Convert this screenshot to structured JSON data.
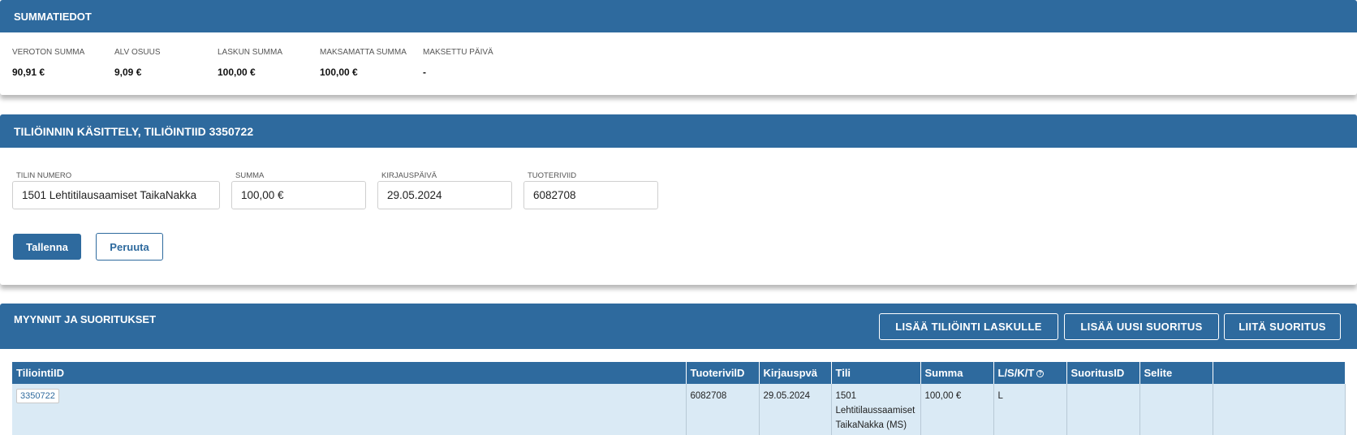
{
  "summary": {
    "title": "SUMMATIEDOT",
    "items": [
      {
        "label": "VEROTON SUMMA",
        "value": "90,91 €"
      },
      {
        "label": "ALV OSUUS",
        "value": "9,09 €"
      },
      {
        "label": "LASKUN SUMMA",
        "value": "100,00 €"
      },
      {
        "label": "MAKSAMATTA SUMMA",
        "value": "100,00 €"
      },
      {
        "label": "MAKSETTU PÄIVÄ",
        "value": "-"
      }
    ]
  },
  "edit": {
    "title": "TILIÖINNIN KÄSITTELY, TILIÖINTIID 3350722",
    "fields": [
      {
        "label": "TILIN NUMERO",
        "value": "1501 Lehtitilausaamiset TaikaNakka"
      },
      {
        "label": "SUMMA",
        "value": "100,00 €"
      },
      {
        "label": "KIRJAUSPÄIVÄ",
        "value": "29.05.2024"
      },
      {
        "label": "TUOTERIVIID",
        "value": "6082708"
      }
    ],
    "save_label": "Tallenna",
    "cancel_label": "Peruuta"
  },
  "sales": {
    "title": "MYYNNIT JA SUORITUKSET",
    "buttons": {
      "add_posting": "LISÄÄ TILIÖINTI LASKULLE",
      "add_payment": "LISÄÄ UUSI SUORITUS",
      "attach_payment": "LIITÄ SUORITUS"
    },
    "columns": [
      "TiliointiID",
      "TuoterivilD",
      "Kirjauspvä",
      "Tili",
      "Summa",
      "L/S/K/T",
      "SuoritusID",
      "Selite",
      ""
    ],
    "rows": [
      {
        "id": "3350722",
        "tuoteriviid": "6082708",
        "kirjauspva": "29.05.2024",
        "tili": "1501 Lehtitilaussaamiset TaikaNakka (MS)",
        "summa": "100,00 €",
        "lskt": "L",
        "suoritusid": "",
        "selite": ""
      }
    ]
  },
  "colors": {
    "header_blue": "#2e6a9e",
    "row_bg": "#daeaf5"
  },
  "icons": {
    "lskt_help": "help-circle-icon"
  }
}
